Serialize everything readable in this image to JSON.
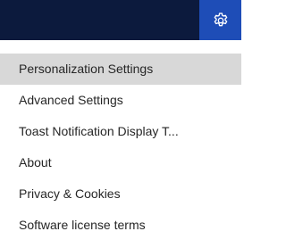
{
  "header": {
    "settings_icon": "gear-icon",
    "background_color": "#0c1a3d",
    "accent_color": "#1e4db7"
  },
  "menu": {
    "items": [
      {
        "label": "Personalization Settings",
        "selected": true
      },
      {
        "label": "Advanced Settings",
        "selected": false
      },
      {
        "label": "Toast Notification Display T...",
        "selected": false
      },
      {
        "label": "About",
        "selected": false
      },
      {
        "label": "Privacy & Cookies",
        "selected": false
      },
      {
        "label": "Software license terms",
        "selected": false
      }
    ]
  }
}
